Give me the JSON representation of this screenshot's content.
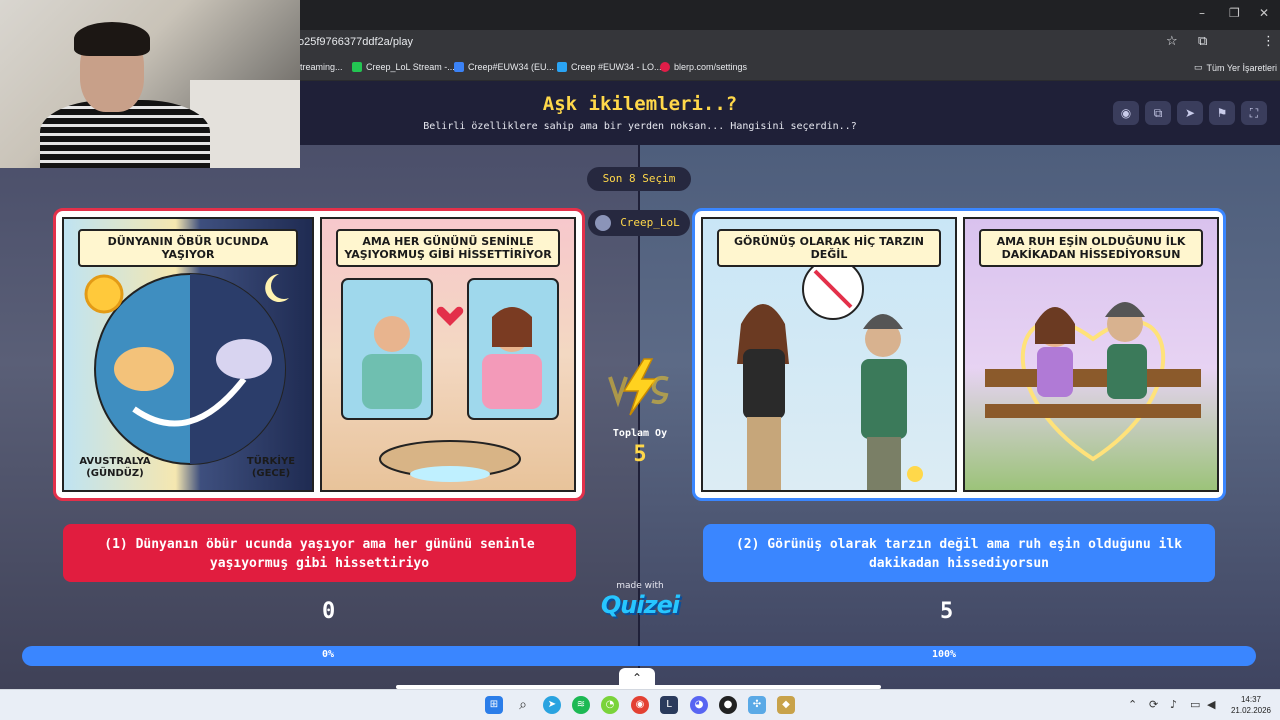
{
  "browser": {
    "url": "o25f9766377ddf2a/play",
    "profile_initial": "s",
    "window_controls": {
      "minimize": "–",
      "restore": "❐",
      "close": "✕"
    },
    "bookmarks": [
      {
        "label": "treaming...",
        "color": "#8a5cf6"
      },
      {
        "label": "Creep_LoL Stream -...",
        "color": "#23c552"
      },
      {
        "label": "Creep#EUW34 (EU...",
        "color": "#3b82f6"
      },
      {
        "label": "Creep #EUW34 - LO...",
        "color": "#2aa4f4"
      },
      {
        "label": "blerp.com/settings",
        "color": "#e11d48"
      }
    ],
    "all_bookmarks": "Tüm Yer İşaretleri"
  },
  "header": {
    "title": "Aşk ikilemleri..?",
    "subtitle": "Belirli özelliklere sahip ama bir yerden noksan... Hangisini seçerdin..?"
  },
  "history_pill": "Son 8 Seçim",
  "streamer_pill": "Creep_LoL",
  "cards": {
    "left": {
      "panel1_banner": "DÜNYANIN ÖBÜR UCUNDA YAŞIYOR",
      "panel1_cap_left": "AVUSTRALYA\n(GÜNDÜZ)",
      "panel1_cap_right": "TÜRKİYE\n(GECE)",
      "panel2_banner": "AMA HER GÜNÜNÜ SENİNLE YAŞIYORMUŞ GİBİ HİSSETTİRİYOR"
    },
    "right": {
      "panel1_banner": "GÖRÜNÜŞ OLARAK HİÇ TARZIN DEĞİL",
      "panel2_banner": "AMA RUH EŞİN OLDUĞUNU İLK DAKİKADAN HİSSEDİYORSUN"
    }
  },
  "total": {
    "label": "Toplam Oy",
    "value": "5"
  },
  "options": {
    "left": "(1) Dünyanın öbür ucunda yaşıyor ama her gününü seninle yaşıyormuş gibi hissettiriyo",
    "right": "(2) Görünüş olarak tarzın değil ama ruh eşin olduğunu ilk dakikadan hissediyorsun"
  },
  "counts": {
    "left": "0",
    "right": "5"
  },
  "made_with": "made with",
  "brand": "Quizei",
  "progress": {
    "left_label": "0%",
    "right_label": "100%",
    "left_fraction": 0.0
  },
  "taskbar": {
    "time": "14:37",
    "date": "21.02.2026"
  },
  "colors": {
    "accent_red": "#e11d3f",
    "accent_blue": "#3a86ff",
    "title_yellow": "#ffd84a"
  }
}
